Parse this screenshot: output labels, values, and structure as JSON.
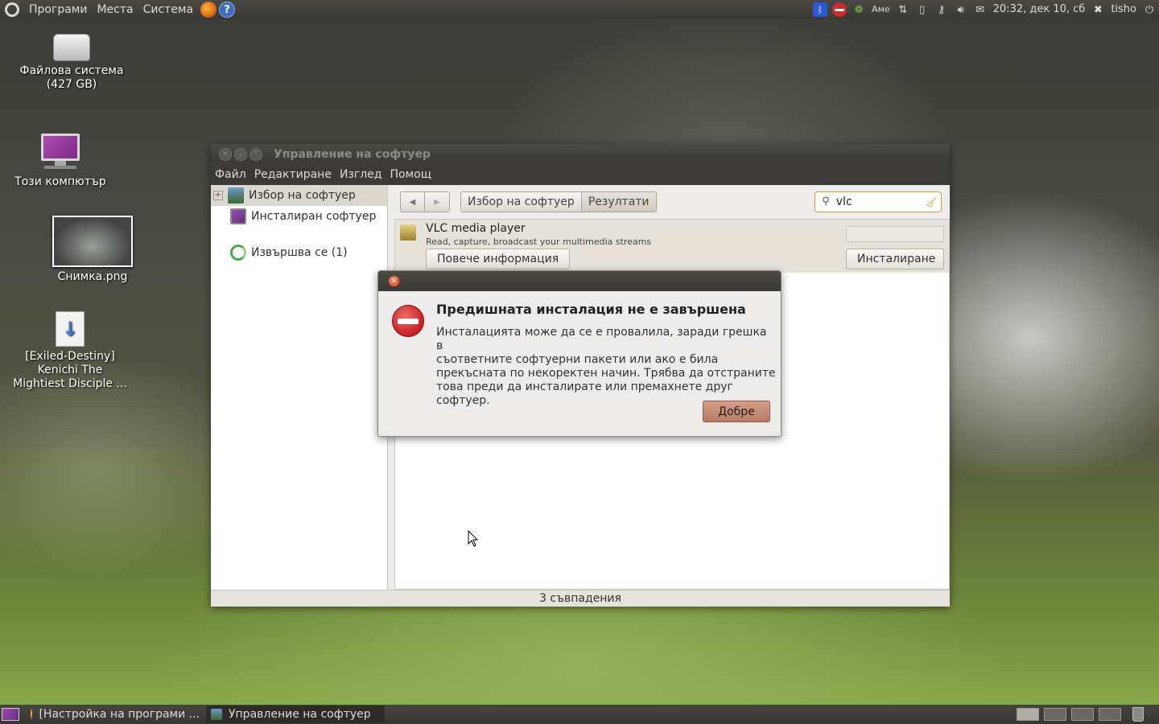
{
  "top_panel": {
    "menus": [
      "Програми",
      "Места",
      "Система"
    ],
    "keyboard_layout": "Аме",
    "clock": "20:32, дек 10, сб",
    "user": "tisho"
  },
  "desktop": {
    "icons": [
      {
        "name_line1": "Файлова система",
        "name_line2": "(427 GB)"
      },
      {
        "name_line1": "Този компютър",
        "name_line2": ""
      },
      {
        "name_line1": "Снимка.png",
        "name_line2": ""
      },
      {
        "name_line1": "[Exiled-Destiny]",
        "name_line2": "Kenichi The",
        "name_line3": "Mightiest Disciple ..."
      }
    ]
  },
  "window": {
    "title": "Управление на софтуер",
    "menu": [
      "Файл",
      "Редактиране",
      "Изглед",
      "Помощ"
    ],
    "sidebar": [
      {
        "label": "Избор на софтуер"
      },
      {
        "label": "Инсталиран софтуер"
      },
      {
        "label": "Извършва се (1)"
      }
    ],
    "breadcrumbs": [
      "Избор на софтуер",
      "Резултати"
    ],
    "search": {
      "value": "vlc",
      "placeholder": ""
    },
    "result": {
      "name": "VLC media player",
      "description": "Read, capture, broadcast your multimedia streams",
      "more_info_label": "Повече информация",
      "install_label": "Инсталиране"
    },
    "status": "3 съвпадения"
  },
  "dialog": {
    "heading": "Предишната инсталация не е завършена",
    "body_lines": [
      "Инсталацията може да се е провалила, заради грешка в",
      "съответните софтуерни пакети или ако е била",
      "прекъсната по некоректен начин. Трябва да отстраните",
      "това преди да инсталирате или премахнете друг софтуер."
    ],
    "ok_label": "Добре"
  },
  "taskbar": {
    "tasks": [
      {
        "label": "[Настройка на програми ..."
      },
      {
        "label": "Управление на софтуер"
      }
    ]
  },
  "colors": {
    "panel": "#3b3934",
    "accent_button": "#c08a72",
    "error": "#c81e1e"
  }
}
